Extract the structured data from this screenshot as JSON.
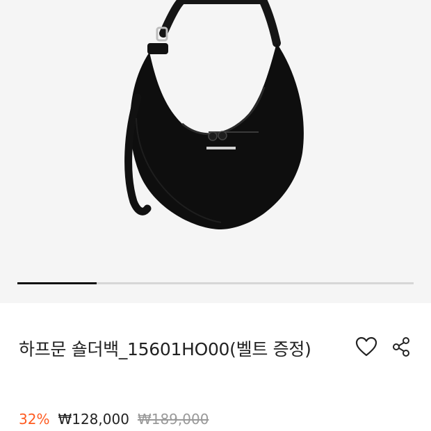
{
  "product": {
    "title": "하프문 숄더백_15601HO00(벨트 증정)",
    "image_count": 5,
    "image_index": 1
  },
  "price": {
    "discount": "32%",
    "sale": "₩128,000",
    "original": "₩189,000"
  },
  "colors": {
    "discount": "#ff5a1f",
    "bag": "#0e0e0e",
    "hero_background": "#f5f5f5"
  },
  "icons": {
    "wishlist": "heart-outline-icon",
    "share": "share-icon"
  }
}
